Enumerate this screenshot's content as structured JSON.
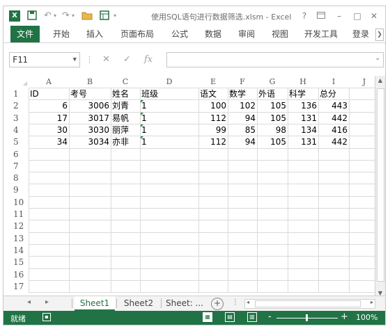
{
  "window": {
    "title": "使用SQL语句进行数据筛选.xlsm - Excel",
    "logo": "X",
    "help": "?",
    "minimize": "–",
    "maximize": "□",
    "close": "✕"
  },
  "qat": {
    "save": "💾",
    "undo": "↶",
    "undo_dd": "▾",
    "redo": "↷",
    "redo_dd": "▾",
    "open": "📂",
    "macro": "▦",
    "more": "▾"
  },
  "ribbon": {
    "tabs": [
      {
        "label": "文件"
      },
      {
        "label": "开始"
      },
      {
        "label": "插入"
      },
      {
        "label": "页面布局"
      },
      {
        "label": "公式"
      },
      {
        "label": "数据"
      },
      {
        "label": "审阅"
      },
      {
        "label": "视图"
      },
      {
        "label": "开发工具"
      },
      {
        "label": "登录"
      }
    ]
  },
  "formula_bar": {
    "name_box": "F11",
    "cancel": "✕",
    "enter": "✓",
    "fx": "fx",
    "value": ""
  },
  "sheet": {
    "col_headers": [
      "A",
      "B",
      "C",
      "D",
      "E",
      "F",
      "G",
      "H",
      "I",
      "J"
    ],
    "row_headers": [
      "1",
      "2",
      "3",
      "4",
      "5",
      "6",
      "7",
      "8",
      "9",
      "10",
      "11",
      "12",
      "13",
      "14",
      "15",
      "16",
      "17"
    ],
    "header_row": [
      "ID",
      "考号",
      "姓名",
      "班级",
      "语文",
      "数学",
      "外语",
      "科学",
      "总分"
    ],
    "rows": [
      [
        "6",
        "3006",
        "刘青",
        "1",
        "100",
        "102",
        "105",
        "136",
        "443"
      ],
      [
        "17",
        "3017",
        "易帆",
        "1",
        "112",
        "94",
        "105",
        "131",
        "442"
      ],
      [
        "30",
        "3030",
        "丽萍",
        "1",
        "99",
        "85",
        "98",
        "134",
        "416"
      ],
      [
        "34",
        "3034",
        "亦非",
        "1",
        "112",
        "94",
        "105",
        "131",
        "442"
      ]
    ]
  },
  "sheet_tabs": {
    "prev": "◂",
    "next": "▸",
    "tabs": [
      {
        "label": "Sheet1",
        "active": true
      },
      {
        "label": "Sheet2",
        "active": false
      },
      {
        "label": "Sheet: ...",
        "active": false
      }
    ],
    "add": "+"
  },
  "status_bar": {
    "mode": "就绪",
    "zoom_minus": "-",
    "zoom_plus": "+",
    "zoom_level": "100%"
  },
  "colors": {
    "accent": "#217346",
    "error_triangle": "#1e8c3a"
  }
}
